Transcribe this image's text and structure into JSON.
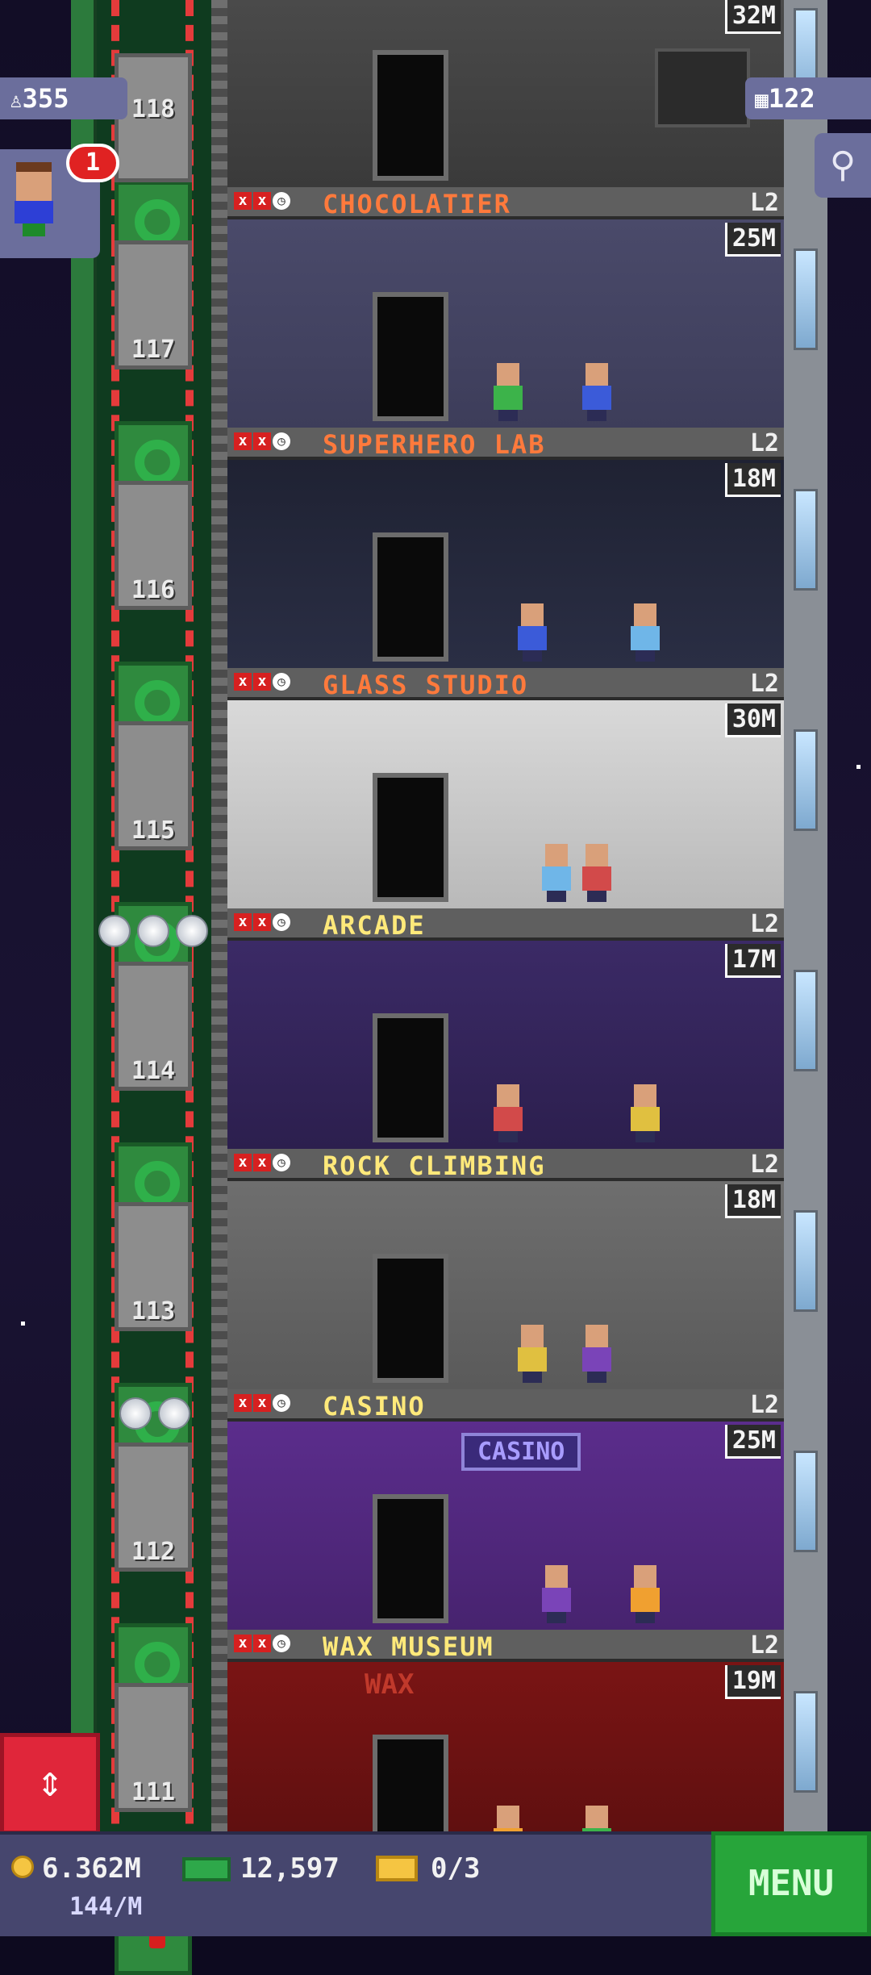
{
  "hud": {
    "population": "355",
    "avatar_notifications": "1",
    "floors_count": "122"
  },
  "elevator": {
    "floor_numbers": [
      "118",
      "117",
      "116",
      "115",
      "114",
      "113",
      "112",
      "111"
    ]
  },
  "top_partial_floor": {
    "price": "32M"
  },
  "floors": [
    {
      "name": "CHOCOLATIER",
      "level": "L2",
      "price": "25M",
      "name_color": "#ff7a3c"
    },
    {
      "name": "SUPERHERO LAB",
      "level": "L2",
      "price": "18M",
      "name_color": "#ff7a3c"
    },
    {
      "name": "GLASS STUDIO",
      "level": "L2",
      "price": "30M",
      "name_color": "#ff7a3c"
    },
    {
      "name": "ARCADE",
      "level": "L2",
      "price": "17M",
      "name_color": "#ffe97a"
    },
    {
      "name": "ROCK CLIMBING",
      "level": "L2",
      "price": "18M",
      "name_color": "#ffe97a"
    },
    {
      "name": "CASINO",
      "level": "L2",
      "price": "25M",
      "name_color": "#ffe97a"
    },
    {
      "name": "WAX MUSEUM",
      "level": "L2",
      "price": "19M",
      "name_color": "#ffe97a"
    }
  ],
  "room_signs": {
    "casino": "CASINO",
    "wax": "WAX"
  },
  "bottom_bar": {
    "coins": "6.362M",
    "income_rate": "144/M",
    "bux": "12,597",
    "tickets": "0/3",
    "menu_label": "MENU"
  },
  "colors": {
    "accent_red": "#e0263a",
    "menu_green": "#27a53a",
    "hud_purple": "#6b6e9c"
  },
  "icons": {
    "population": "person-icon",
    "floors": "building-icon",
    "search": "magnifier-icon",
    "elevator": "up-down-arrows-icon"
  }
}
